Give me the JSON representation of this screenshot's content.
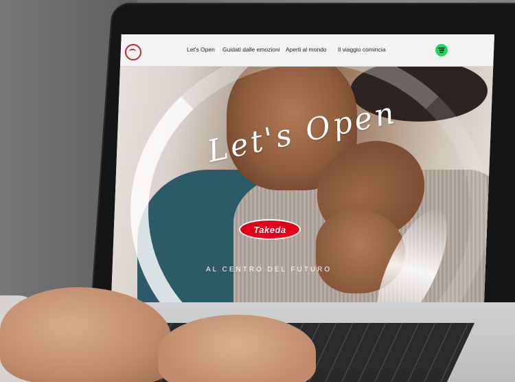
{
  "nav": {
    "items": [
      "Let's Open",
      "Guidati dalle emozioni",
      "Aperti al mondo",
      "Il viaggio comincia"
    ]
  },
  "hero": {
    "title": "Let's Open",
    "brand": "Takeda",
    "tagline": "AL CENTRO DEL FUTURO"
  },
  "colors": {
    "brand_red": "#e2001a",
    "spotify_green": "#1ed760"
  },
  "icons": {
    "nav_logo": "takeda-circle-logo-icon",
    "spotify": "spotify-icon"
  }
}
